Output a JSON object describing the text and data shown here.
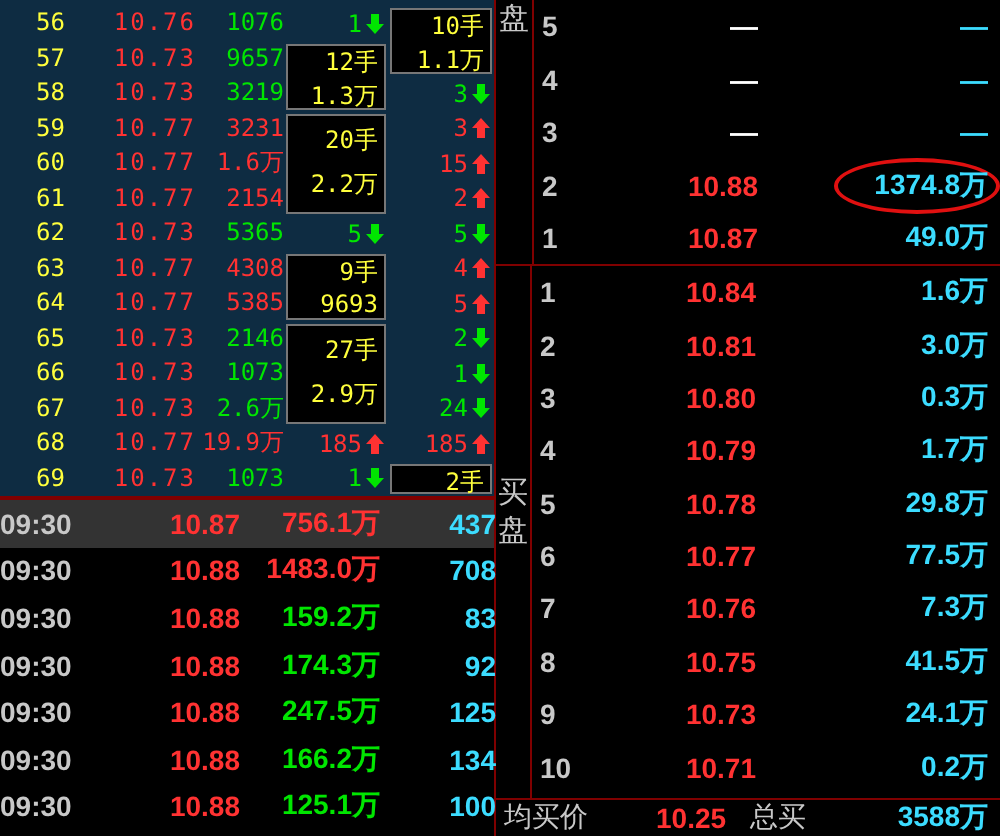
{
  "tick_rows": [
    {
      "index": "56",
      "price": "10.76",
      "volume": "1076",
      "up": false,
      "orders": {
        "kind": "count",
        "text": "1",
        "up": false
      },
      "orders_b": {
        "kind": "box",
        "lines": [
          "10手",
          "1.1万"
        ]
      }
    },
    {
      "index": "57",
      "price": "10.73",
      "volume": "9657",
      "up": false,
      "orders": {
        "kind": "box",
        "lines": [
          "12手",
          "1.3万"
        ]
      }
    },
    {
      "index": "58",
      "price": "10.73",
      "volume": "3219",
      "up": false,
      "orders_b": {
        "kind": "count",
        "text": "3",
        "up": false
      }
    },
    {
      "index": "59",
      "price": "10.77",
      "volume": "3231",
      "up": true,
      "orders": {
        "kind": "box",
        "lines": [
          "20手",
          "2.2万"
        ]
      },
      "orders_b": {
        "kind": "count",
        "text": "3",
        "up": true
      }
    },
    {
      "index": "60",
      "price": "10.77",
      "volume": "1.6万",
      "up": true,
      "orders_b": {
        "kind": "count",
        "text": "15",
        "up": true
      }
    },
    {
      "index": "61",
      "price": "10.77",
      "volume": "2154",
      "up": true,
      "orders_b": {
        "kind": "count",
        "text": "2",
        "up": true
      }
    },
    {
      "index": "62",
      "price": "10.73",
      "volume": "5365",
      "up": false,
      "orders": {
        "kind": "count",
        "text": "5",
        "up": false
      },
      "orders_b": {
        "kind": "count",
        "text": "5",
        "up": false
      }
    },
    {
      "index": "63",
      "price": "10.77",
      "volume": "4308",
      "up": true,
      "orders": {
        "kind": "box",
        "lines": [
          "9手",
          "9693"
        ]
      },
      "orders_b": {
        "kind": "count",
        "text": "4",
        "up": true
      }
    },
    {
      "index": "64",
      "price": "10.77",
      "volume": "5385",
      "up": true,
      "orders_b": {
        "kind": "count",
        "text": "5",
        "up": true
      }
    },
    {
      "index": "65",
      "price": "10.73",
      "volume": "2146",
      "up": false,
      "orders": {
        "kind": "box",
        "lines": [
          "27手",
          "2.9万"
        ]
      },
      "orders_b": {
        "kind": "count",
        "text": "2",
        "up": false
      }
    },
    {
      "index": "66",
      "price": "10.73",
      "volume": "1073",
      "up": false,
      "orders_b": {
        "kind": "count",
        "text": "1",
        "up": false
      }
    },
    {
      "index": "67",
      "price": "10.73",
      "volume": "2.6万",
      "up": false,
      "orders_b": {
        "kind": "count",
        "text": "24",
        "up": false
      }
    },
    {
      "index": "68",
      "price": "10.77",
      "volume": "19.9万",
      "up": true,
      "orders": {
        "kind": "count",
        "text": "185",
        "up": true
      },
      "orders_b": {
        "kind": "count",
        "text": "185",
        "up": true
      }
    },
    {
      "index": "69",
      "price": "10.73",
      "volume": "1073",
      "up": false,
      "orders": {
        "kind": "count",
        "text": "1",
        "up": false
      },
      "orders_b": {
        "kind": "box",
        "lines": [
          "2手"
        ]
      }
    }
  ],
  "trades": [
    {
      "time": "09:30",
      "price": "10.87",
      "amount": "756.1万",
      "count": "437",
      "up": true,
      "selected": true
    },
    {
      "time": "09:30",
      "price": "10.88",
      "amount": "1483.0万",
      "count": "708",
      "up": true,
      "selected": false
    },
    {
      "time": "09:30",
      "price": "10.88",
      "amount": "159.2万",
      "count": "83",
      "up": false,
      "selected": false
    },
    {
      "time": "09:30",
      "price": "10.88",
      "amount": "174.3万",
      "count": "92",
      "up": false,
      "selected": false
    },
    {
      "time": "09:30",
      "price": "10.88",
      "amount": "247.5万",
      "count": "125",
      "up": false,
      "selected": false
    },
    {
      "time": "09:30",
      "price": "10.88",
      "amount": "166.2万",
      "count": "134",
      "up": false,
      "selected": false
    },
    {
      "time": "09:30",
      "price": "10.88",
      "amount": "125.1万",
      "count": "100",
      "up": false,
      "selected": false
    }
  ],
  "order_book": {
    "sell_label": "盘",
    "sell": [
      {
        "level": "5",
        "price": "—",
        "volume": "—",
        "circled": false
      },
      {
        "level": "4",
        "price": "—",
        "volume": "—",
        "circled": false
      },
      {
        "level": "3",
        "price": "—",
        "volume": "—",
        "circled": false
      },
      {
        "level": "2",
        "price": "10.88",
        "volume": "1374.8万",
        "circled": true
      },
      {
        "level": "1",
        "price": "10.87",
        "volume": "49.0万",
        "circled": false
      }
    ],
    "buy_label": [
      "买",
      "盘"
    ],
    "buy": [
      {
        "level": "1",
        "price": "10.84",
        "volume": "1.6万"
      },
      {
        "level": "2",
        "price": "10.81",
        "volume": "3.0万"
      },
      {
        "level": "3",
        "price": "10.80",
        "volume": "0.3万"
      },
      {
        "level": "4",
        "price": "10.79",
        "volume": "1.7万"
      },
      {
        "level": "5",
        "price": "10.78",
        "volume": "29.8万"
      },
      {
        "level": "6",
        "price": "10.77",
        "volume": "77.5万"
      },
      {
        "level": "7",
        "price": "10.76",
        "volume": "7.3万"
      },
      {
        "level": "8",
        "price": "10.75",
        "volume": "41.5万"
      },
      {
        "level": "9",
        "price": "10.73",
        "volume": "24.1万"
      },
      {
        "level": "10",
        "price": "10.71",
        "volume": "0.2万"
      }
    ],
    "summary": {
      "avg_label": "均买价",
      "avg_price": "10.25",
      "total_label": "总买",
      "total": "3588万"
    }
  }
}
